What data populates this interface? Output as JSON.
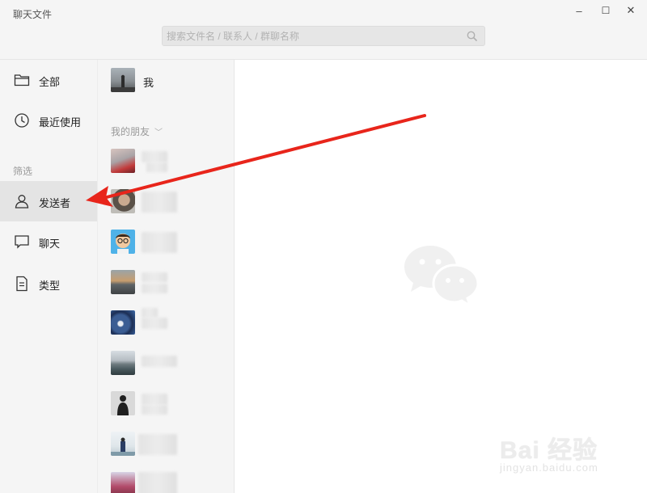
{
  "window": {
    "title": "聊天文件",
    "controls": {
      "minimize": "–",
      "maximize": "☐",
      "close": "✕"
    }
  },
  "search": {
    "placeholder": "搜索文件名 / 联系人 / 群聊名称",
    "value": ""
  },
  "sidebar": {
    "items": [
      {
        "label": "全部",
        "icon": "folder-icon"
      },
      {
        "label": "最近使用",
        "icon": "clock-icon"
      }
    ],
    "filter_section_label": "筛选",
    "filters": [
      {
        "label": "发送者",
        "icon": "person-icon",
        "active": true
      },
      {
        "label": "聊天",
        "icon": "chat-bubble-icon",
        "active": false
      },
      {
        "label": "类型",
        "icon": "document-icon",
        "active": false
      }
    ]
  },
  "contacts": {
    "me_label": "我",
    "friends_header": "我的朋友",
    "friends_chevron": "﹀",
    "friends": [
      {
        "avatar": "motorcycle-avatar"
      },
      {
        "avatar": "man-avatar"
      },
      {
        "avatar": "cartoon-boy-avatar"
      },
      {
        "avatar": "sunset-avatar"
      },
      {
        "avatar": "blue-flowers-avatar"
      },
      {
        "avatar": "lake-avatar"
      },
      {
        "avatar": "bw-portrait-avatar"
      },
      {
        "avatar": "outdoor-avatar"
      },
      {
        "avatar": "person-red-avatar"
      }
    ]
  },
  "main": {
    "placeholder_icon": "wechat-logo-icon"
  },
  "watermark": {
    "brand": "Bai 经验",
    "sub": "jingyan.baidu.com"
  },
  "annotation": {
    "arrow_color": "#e8251b"
  }
}
